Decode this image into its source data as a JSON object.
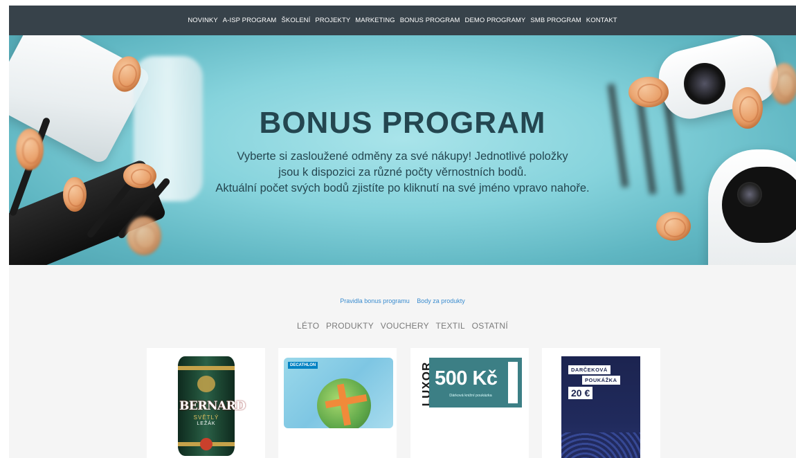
{
  "nav": {
    "items": [
      "NOVINKY",
      "A-ISP PROGRAM",
      "ŠKOLENÍ",
      "PROJEKTY",
      "MARKETING",
      "BONUS PROGRAM",
      "DEMO PROGRAMY",
      "SMB PROGRAM",
      "KONTAKT"
    ]
  },
  "hero": {
    "title": "BONUS PROGRAM",
    "line1": "Vyberte si zasloužené odměny za své nákupy! Jednotlivé položky",
    "line2": "jsou k dispozici za různé počty věrnostních bodů.",
    "line3": "Aktuální počet svých bodů zjistíte po kliknutí na své jméno vpravo nahoře.",
    "colors": {
      "accent": "#244650",
      "bg": "#86d3dc"
    }
  },
  "links": [
    "Pravidla bonus programu",
    "Body za produkty"
  ],
  "categories": [
    "LÉTO",
    "PRODUKTY",
    "VOUCHERY",
    "TEXTIL",
    "OSTATNÍ"
  ],
  "products": {
    "keg": {
      "brand": "BERNARD",
      "sub1": "SVĚTLÝ",
      "sub2": "LEŽÁK"
    },
    "decathlon": {
      "logo": "DECATHLON"
    },
    "luxor": {
      "brand": "LUXOR",
      "amount": "500 Kč",
      "subtitle": "Dárková knižní poukázka"
    },
    "darcekova": {
      "line1": "DARČEKOVÁ",
      "line2": "POUKÁŽKA",
      "amount": "20 €"
    }
  },
  "icons": [
    "coin-icon",
    "router-image",
    "camera-image"
  ]
}
